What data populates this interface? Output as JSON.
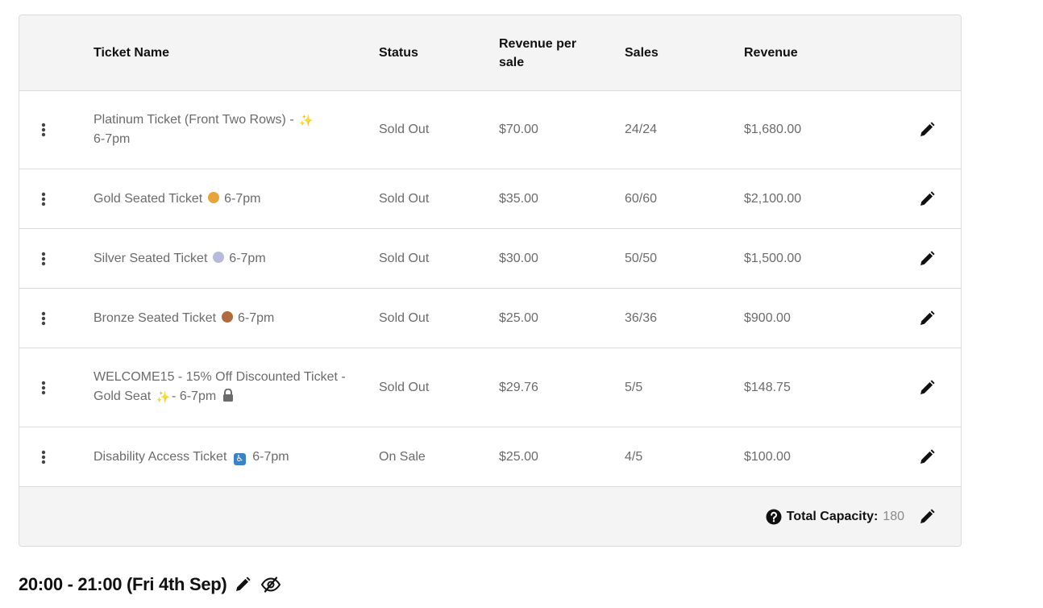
{
  "table": {
    "headers": {
      "name": "Ticket Name",
      "status": "Status",
      "revenue_per_sale": "Revenue per sale",
      "sales": "Sales",
      "revenue": "Revenue"
    },
    "rows": [
      {
        "name_parts": [
          "Platinum Ticket (Front Two Rows) - ",
          "✨",
          " 6-7pm"
        ],
        "status": "Sold Out",
        "revenue_per_sale": "$70.00",
        "sales": "24/24",
        "revenue": "$1,680.00"
      },
      {
        "name_parts": [
          "Gold Seated Ticket ",
          "1",
          " 6-7pm"
        ],
        "status": "Sold Out",
        "revenue_per_sale": "$35.00",
        "sales": "60/60",
        "revenue": "$2,100.00"
      },
      {
        "name_parts": [
          "Silver Seated Ticket ",
          "2",
          " 6-7pm"
        ],
        "status": "Sold Out",
        "revenue_per_sale": "$30.00",
        "sales": "50/50",
        "revenue": "$1,500.00"
      },
      {
        "name_parts": [
          "Bronze Seated Ticket ",
          "3",
          " 6-7pm"
        ],
        "status": "Sold Out",
        "revenue_per_sale": "$25.00",
        "sales": "36/36",
        "revenue": "$900.00"
      },
      {
        "name_parts": [
          "WELCOME15 - 15% Off Discounted Ticket - Gold Seat ",
          "✨",
          "- 6-7pm"
        ],
        "status": "Sold Out",
        "revenue_per_sale": "$29.76",
        "sales": "5/5",
        "revenue": "$148.75"
      },
      {
        "name_parts": [
          "Disability Access Ticket ",
          "♿",
          " 6-7pm"
        ],
        "status": "On Sale",
        "revenue_per_sale": "$25.00",
        "sales": "4/5",
        "revenue": "$100.00"
      }
    ],
    "footer": {
      "capacity_label": "Total Capacity:",
      "capacity_value": "180"
    }
  },
  "slot": {
    "title": "20:00 - 21:00 (Fri 4th Sep)"
  },
  "icons": {
    "drag": "vertical-ellipsis-icon",
    "edit": "pencil-icon",
    "help": "question-circle-icon",
    "hidden": "eye-slash-icon",
    "lock": "lock-icon"
  },
  "colors": {
    "header_bg": "#f4f4f4",
    "muted_text": "#6b6b6b",
    "border": "#dcdcdc"
  }
}
